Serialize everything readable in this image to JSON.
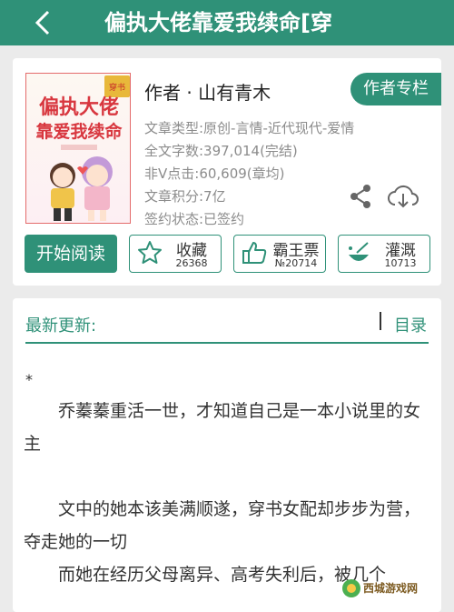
{
  "header": {
    "back_icon": "back-chevron-icon",
    "title": "偏执大佬靠爱我续命[穿"
  },
  "book": {
    "cover_title": "偏执大佬靠爱我续命",
    "cover_tag": "穿书",
    "author_line": "作者 · 山有青木",
    "author_column_label": "作者专栏",
    "type_line": "文章类型:原创-言情-近代现代-爱情",
    "word_count_line": "全文字数:397,014(完结)",
    "clicks_line": "非Ⅴ点击:60,609(章均)",
    "score_line": "文章积分:7亿",
    "contract_line": "签约状态:已签约",
    "share_icon": "share-icon",
    "download_icon": "cloud-download-icon"
  },
  "actions": {
    "read_label": "开始阅读",
    "favorite": {
      "label": "收藏",
      "count": "26368",
      "icon": "star-icon"
    },
    "overlord": {
      "label": "霸王票",
      "count": "№20714",
      "icon": "thumbs-up-icon"
    },
    "nutrient": {
      "label": "灌溉",
      "count": "10713",
      "icon": "watering-icon"
    }
  },
  "latest": {
    "label": "最新更新:",
    "catalog_label": "目录",
    "star_mark": "*",
    "paragraphs": [
      "　　乔蓁蓁重活一世，才知道自己是一本小说里的女主",
      "　　文中的她本该美满顺遂，穿书女配却步步为营，夺走她的一切",
      "　　而她在经历父母离异、高考失利后，被几个"
    ]
  },
  "watermark": {
    "text": "西城游戏网"
  },
  "colors": {
    "accent": "#2f9178",
    "background": "#ebebeb"
  }
}
